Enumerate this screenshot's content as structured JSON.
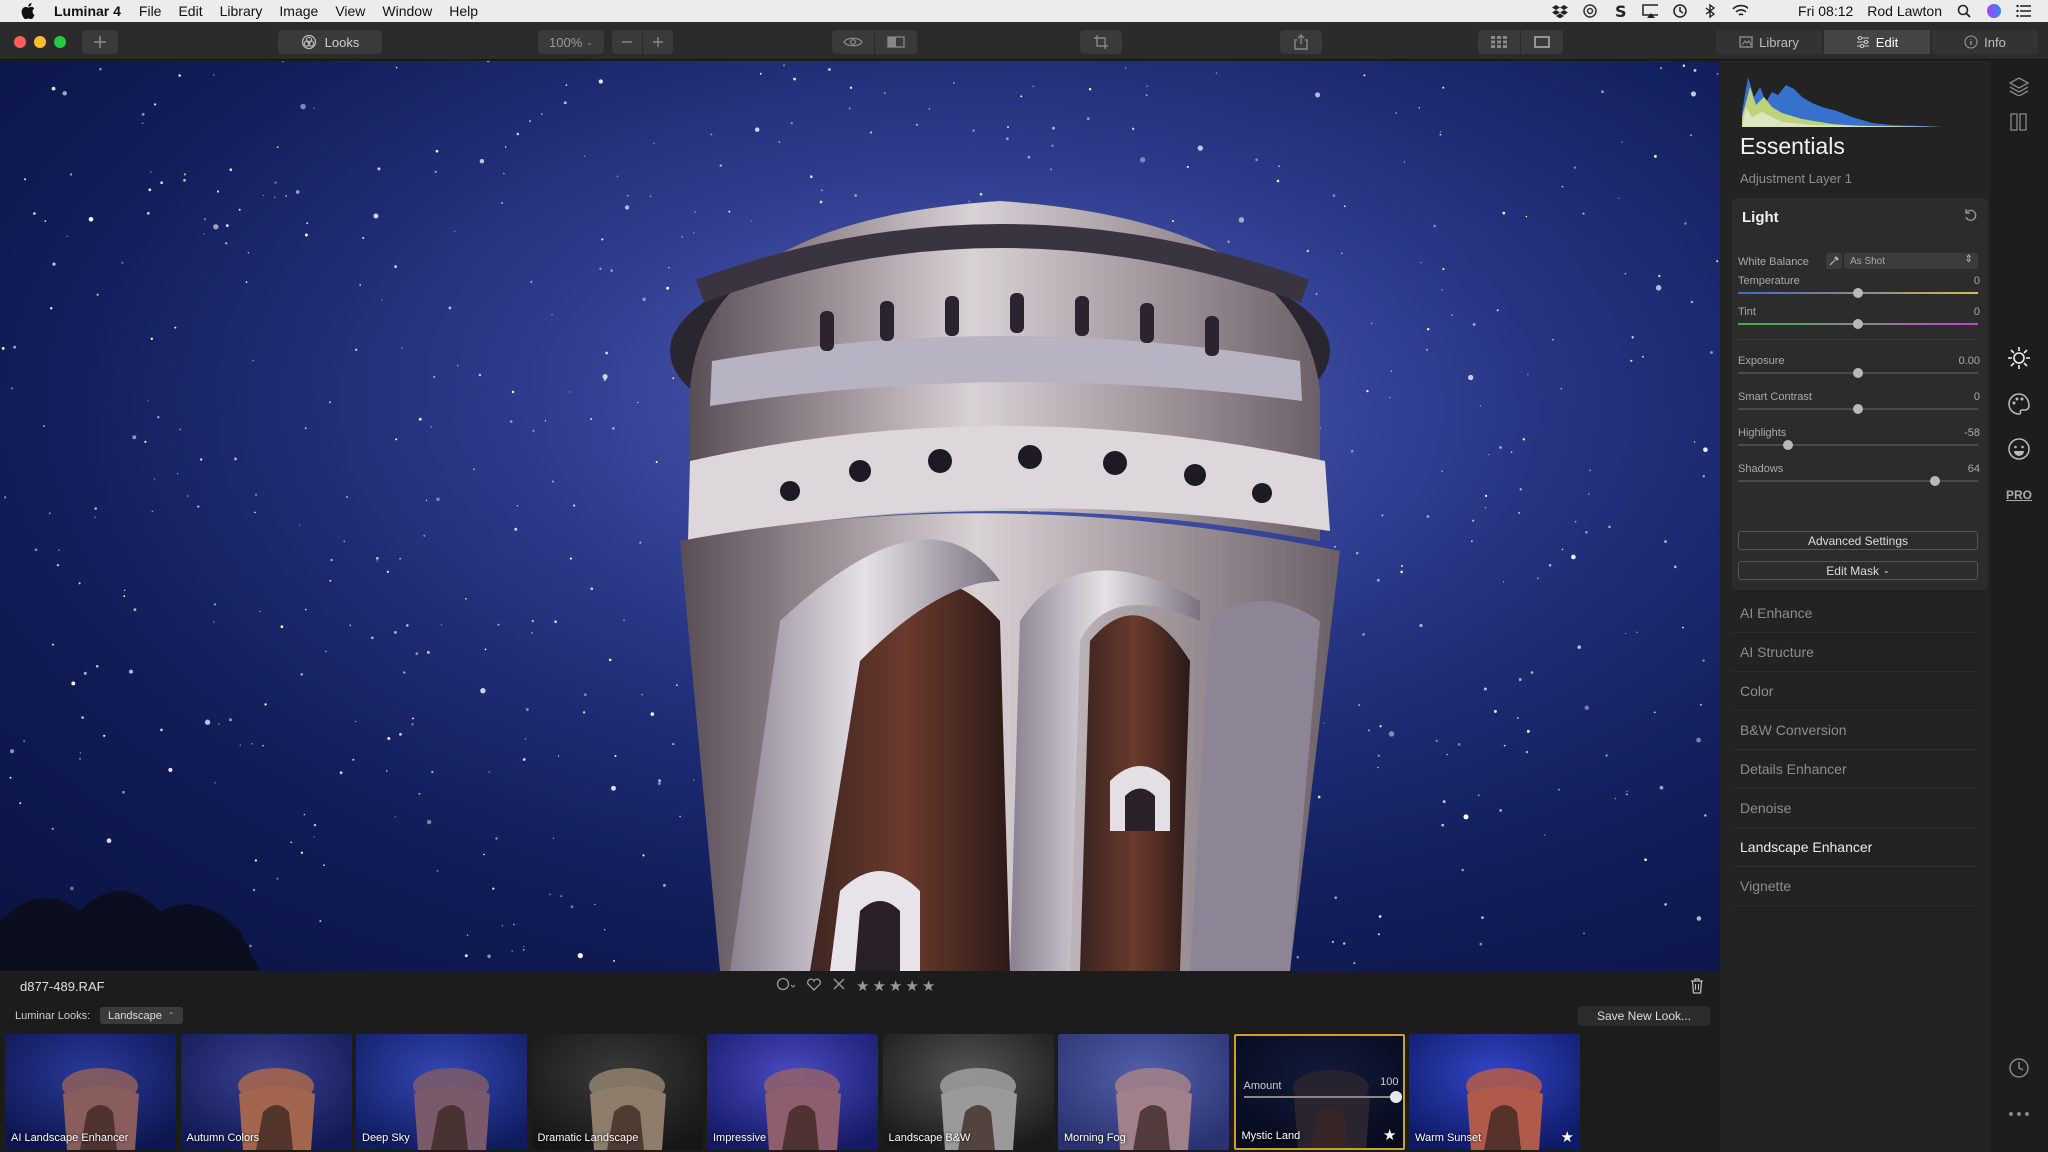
{
  "menubar": {
    "app_name": "Luminar 4",
    "items": [
      "File",
      "Edit",
      "Library",
      "Image",
      "View",
      "Window",
      "Help"
    ],
    "clock": "Fri 08:12",
    "user": "Rod Lawton",
    "tray_icons": [
      "dropbox-icon",
      "cc-icon",
      "s-icon",
      "airplay-icon",
      "time-machine-icon",
      "bluetooth-icon",
      "wifi-icon",
      "search-icon",
      "siri-icon",
      "notification-list-icon"
    ]
  },
  "toolbar": {
    "looks_label": "Looks",
    "zoom_label": "100%",
    "modes": [
      {
        "label": "Library",
        "icon": "library-icon"
      },
      {
        "label": "Edit",
        "icon": "sliders-icon"
      },
      {
        "label": "Info",
        "icon": "info-icon"
      }
    ],
    "active_mode": "Edit"
  },
  "photo": {
    "filename": "d877-489.RAF"
  },
  "looks": {
    "label": "Luminar Looks:",
    "category": "Landscape",
    "save_label": "Save New Look...",
    "items": [
      {
        "name": "AI Landscape Enhancer"
      },
      {
        "name": "Autumn Colors"
      },
      {
        "name": "Deep Sky"
      },
      {
        "name": "Dramatic Landscape"
      },
      {
        "name": "Impressive"
      },
      {
        "name": "Landscape B&W"
      },
      {
        "name": "Morning Fog"
      },
      {
        "name": "Mystic Land"
      },
      {
        "name": "Warm Sunset"
      }
    ],
    "selected": "Mystic Land",
    "amount_label": "Amount",
    "amount_value": "100",
    "amount_fraction": 1.0
  },
  "panel": {
    "title": "Essentials",
    "subtitle": "Adjustment Layer 1",
    "light": {
      "title": "Light",
      "white_balance_label": "White Balance",
      "white_balance_value": "As Shot",
      "sliders": [
        {
          "label": "Temperature",
          "value": "0",
          "fraction": 0.5
        },
        {
          "label": "Tint",
          "value": "0",
          "fraction": 0.5
        },
        {
          "label": "Exposure",
          "value": "0.00",
          "fraction": 0.5
        },
        {
          "label": "Smart Contrast",
          "value": "0",
          "fraction": 0.5
        },
        {
          "label": "Highlights",
          "value": "-58",
          "fraction": 0.21
        },
        {
          "label": "Shadows",
          "value": "64",
          "fraction": 0.82
        }
      ],
      "advanced_label": "Advanced Settings",
      "edit_mask_label": "Edit Mask"
    },
    "tools": [
      {
        "label": "AI Enhance"
      },
      {
        "label": "AI Structure"
      },
      {
        "label": "Color"
      },
      {
        "label": "B&W Conversion"
      },
      {
        "label": "Details Enhancer"
      },
      {
        "label": "Denoise"
      },
      {
        "label": "Landscape Enhancer"
      },
      {
        "label": "Vignette"
      }
    ],
    "active_tool": "Landscape Enhancer"
  },
  "iconbar": {
    "pro_label": "PRO"
  }
}
